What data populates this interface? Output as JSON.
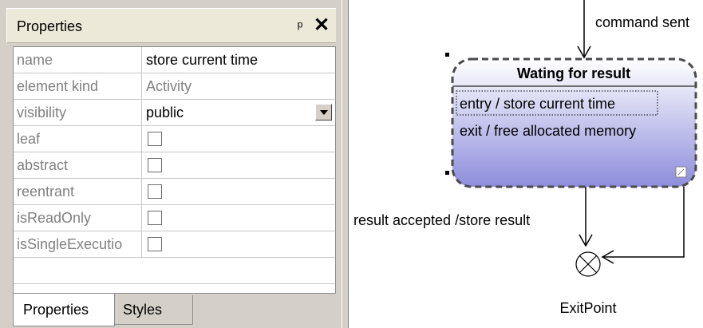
{
  "properties_panel": {
    "title": "Properties",
    "pin_icon": "pin-icon",
    "close_glyph": "✕",
    "rows": [
      {
        "name": "name",
        "value": "store current time",
        "kind": "text"
      },
      {
        "name": "element kind",
        "value": "Activity",
        "kind": "readonly"
      },
      {
        "name": "visibility",
        "value": "public",
        "kind": "dropdown"
      },
      {
        "name": "leaf",
        "kind": "checkbox",
        "checked": false
      },
      {
        "name": "abstract",
        "kind": "checkbox",
        "checked": false
      },
      {
        "name": "reentrant",
        "kind": "checkbox",
        "checked": false
      },
      {
        "name": "isReadOnly",
        "kind": "checkbox",
        "checked": false
      },
      {
        "name": "isSingleExecutio",
        "kind": "checkbox",
        "checked": false
      }
    ],
    "tabs": [
      {
        "label": "Properties",
        "active": true
      },
      {
        "label": "Styles",
        "active": false
      }
    ]
  },
  "diagram": {
    "incoming_transition_label": "command sent",
    "state": {
      "name": "Wating for result",
      "activities": [
        "entry / store current time",
        "exit / free allocated memory"
      ],
      "gradient_top": "#ffffff",
      "gradient_bottom": "#8d8ddc"
    },
    "outgoing_transition_label": "result accepted /store result",
    "exit_point_label": "ExitPoint"
  }
}
